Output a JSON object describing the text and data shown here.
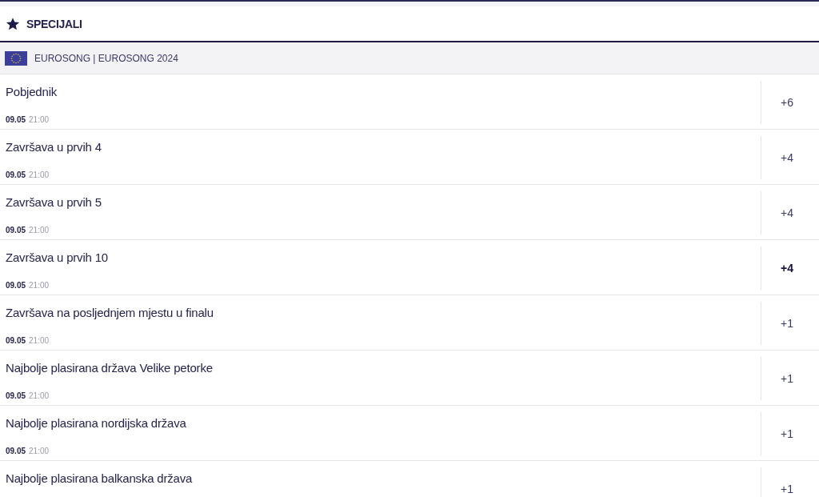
{
  "section": {
    "title": "SPECIJALI"
  },
  "league": {
    "title": "EUROSONG | EUROSONG 2024"
  },
  "markets": [
    {
      "name": "Pobjednik",
      "date": "09.05",
      "time": "21:00",
      "count": "+6",
      "selected": false
    },
    {
      "name": "Završava u prvih 4",
      "date": "09.05",
      "time": "21:00",
      "count": "+4",
      "selected": false
    },
    {
      "name": "Završava u prvih 5",
      "date": "09.05",
      "time": "21:00",
      "count": "+4",
      "selected": false
    },
    {
      "name": "Završava u prvih 10",
      "date": "09.05",
      "time": "21:00",
      "count": "+4",
      "selected": true
    },
    {
      "name": "Završava na posljednjem mjestu u finalu",
      "date": "09.05",
      "time": "21:00",
      "count": "+1",
      "selected": false
    },
    {
      "name": "Najbolje plasirana država Velike petorke",
      "date": "09.05",
      "time": "21:00",
      "count": "+1",
      "selected": false
    },
    {
      "name": "Najbolje plasirana nordijska država",
      "date": "09.05",
      "time": "21:00",
      "count": "+1",
      "selected": false
    },
    {
      "name": "Najbolje plasirana balkanska država",
      "count": "+1",
      "selected": false
    }
  ]
}
